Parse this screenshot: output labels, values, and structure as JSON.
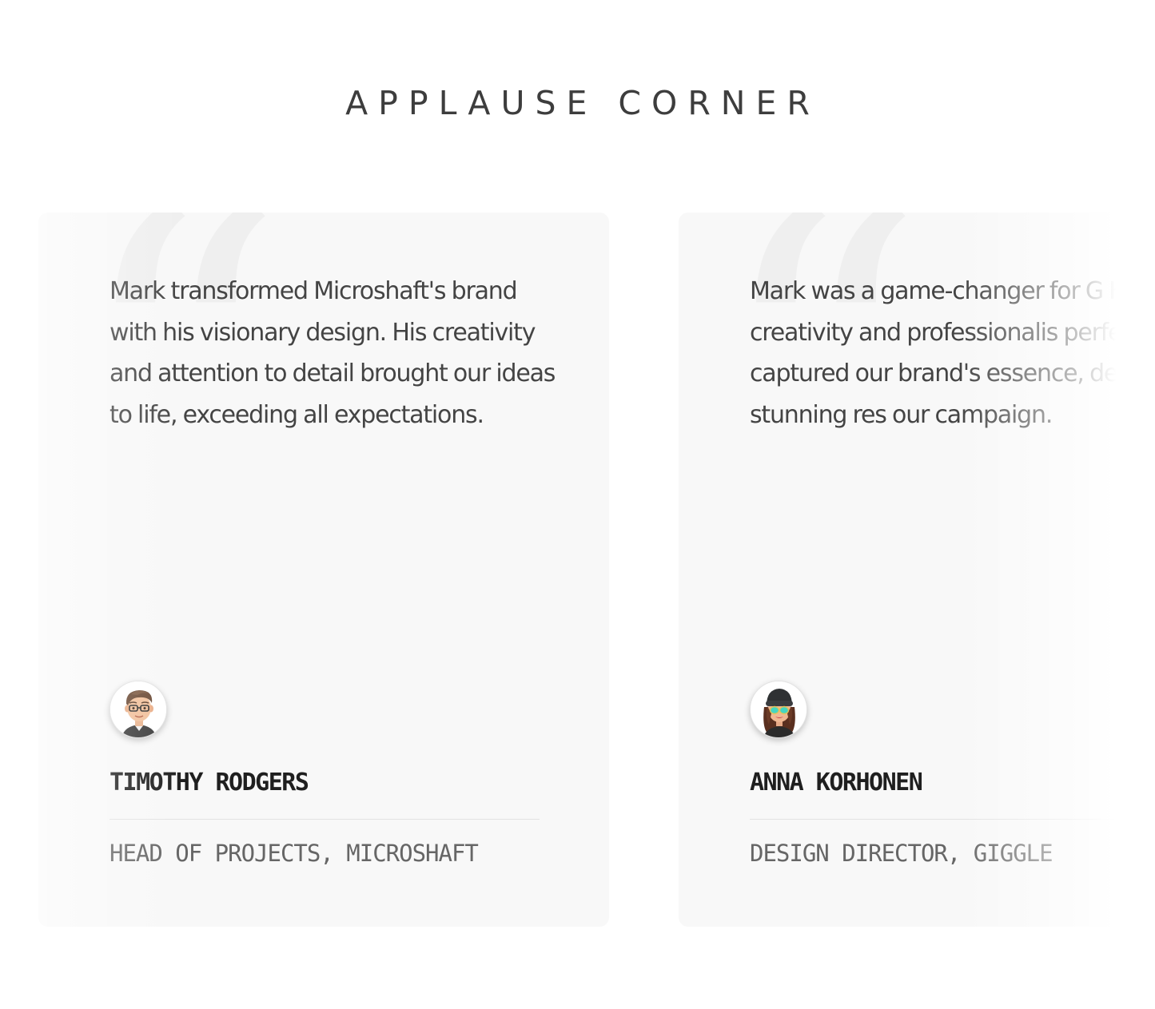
{
  "section": {
    "title": "APPLAUSE CORNER"
  },
  "testimonials": [
    {
      "quote": "Mark transformed Microshaft's brand with his visionary design. His creativity and attention to detail brought our ideas to life, exceeding all expectations.",
      "name": "TIMOTHY RODGERS",
      "role": "HEAD OF PROJECTS, MICROSHAFT",
      "avatar_icon": "memoji-man-glasses-icon"
    },
    {
      "quote": "Mark was a game-changer for G His creativity and professionalis perfectly captured our brand's essence, delivering stunning res our campaign.",
      "name": "ANNA KORHONEN",
      "role": "DESIGN DIRECTOR, GIGGLE",
      "avatar_icon": "memoji-woman-sunglasses-icon"
    }
  ],
  "colors": {
    "card_background": "#f8f8f8",
    "quote_mark": "#efefef",
    "title_text": "#3d3d3d",
    "body_text": "#444444",
    "role_text": "#666666",
    "divider": "#e2e2e2"
  }
}
